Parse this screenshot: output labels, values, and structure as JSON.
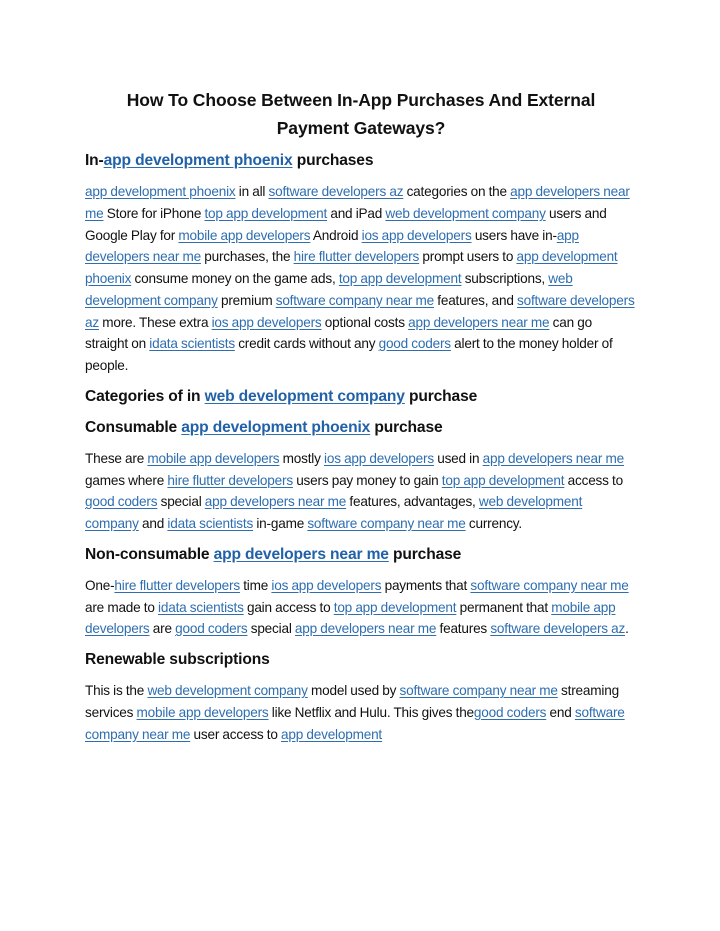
{
  "document": {
    "title": "How To Choose Between In-App Purchases And External Payment Gateways?",
    "link_color": "#2e6eb0",
    "text_color": "#111111",
    "sections": [
      {
        "heading": [
          {
            "t": "In-"
          },
          {
            "t": "app development phoenix",
            "link": true
          },
          {
            "t": " purchases"
          }
        ],
        "paragraph": [
          {
            "t": "app development phoenix",
            "link": true
          },
          {
            "t": " in all "
          },
          {
            "t": "software developers az",
            "link": true
          },
          {
            "t": " categories on the "
          },
          {
            "t": "app developers near me",
            "link": true
          },
          {
            "t": " Store for iPhone "
          },
          {
            "t": "top app development",
            "link": true
          },
          {
            "t": " and iPad "
          },
          {
            "t": "web development company",
            "link": true
          },
          {
            "t": " users and Google Play for "
          },
          {
            "t": "mobile app developers",
            "link": true
          },
          {
            "t": " Android "
          },
          {
            "t": "ios app developers",
            "link": true
          },
          {
            "t": " users have in-"
          },
          {
            "t": "app developers near me",
            "link": true
          },
          {
            "t": " purchases, the "
          },
          {
            "t": "hire flutter developers",
            "link": true
          },
          {
            "t": " prompt users to "
          },
          {
            "t": "app development phoenix",
            "link": true
          },
          {
            "t": " consume money on the game ads, "
          },
          {
            "t": "top app development",
            "link": true
          },
          {
            "t": " subscriptions, "
          },
          {
            "t": "web development company",
            "link": true
          },
          {
            "t": " premium "
          },
          {
            "t": "software company near me",
            "link": true
          },
          {
            "t": " features, and "
          },
          {
            "t": "software developers az",
            "link": true
          },
          {
            "t": " more. These extra "
          },
          {
            "t": "ios app developers",
            "link": true
          },
          {
            "t": " optional costs "
          },
          {
            "t": "app developers near me",
            "link": true
          },
          {
            "t": " can go straight on "
          },
          {
            "t": "idata scientists",
            "link": true
          },
          {
            "t": " credit cards without any "
          },
          {
            "t": "good coders",
            "link": true
          },
          {
            "t": " alert to the money holder of people."
          }
        ]
      },
      {
        "heading": [
          {
            "t": "Categories of in "
          },
          {
            "t": "web development company",
            "link": true
          },
          {
            "t": " purchase"
          }
        ],
        "paragraph": null
      },
      {
        "heading": [
          {
            "t": "Consumable "
          },
          {
            "t": "app development phoenix",
            "link": true
          },
          {
            "t": " purchase"
          }
        ],
        "paragraph": [
          {
            "t": "These are "
          },
          {
            "t": "mobile app developers",
            "link": true
          },
          {
            "t": " mostly "
          },
          {
            "t": "ios app developers",
            "link": true
          },
          {
            "t": " used in "
          },
          {
            "t": "app developers near me",
            "link": true
          },
          {
            "t": " games where "
          },
          {
            "t": "hire flutter developers",
            "link": true
          },
          {
            "t": " users pay money to gain "
          },
          {
            "t": "top app development",
            "link": true
          },
          {
            "t": " access to "
          },
          {
            "t": "good coders",
            "link": true
          },
          {
            "t": " special "
          },
          {
            "t": "app developers near me",
            "link": true
          },
          {
            "t": " features, advantages, "
          },
          {
            "t": "web development company",
            "link": true
          },
          {
            "t": " and "
          },
          {
            "t": "idata scientists",
            "link": true
          },
          {
            "t": " in-game "
          },
          {
            "t": "software company near me",
            "link": true
          },
          {
            "t": " currency."
          }
        ]
      },
      {
        "heading": [
          {
            "t": "Non-consumable "
          },
          {
            "t": "app developers near me",
            "link": true
          },
          {
            "t": " purchase"
          }
        ],
        "paragraph": [
          {
            "t": "One-"
          },
          {
            "t": "hire flutter developers",
            "link": true
          },
          {
            "t": " time "
          },
          {
            "t": "ios app developers",
            "link": true
          },
          {
            "t": " payments that "
          },
          {
            "t": "software company near me",
            "link": true
          },
          {
            "t": " are made to "
          },
          {
            "t": "idata scientists",
            "link": true
          },
          {
            "t": " gain access to "
          },
          {
            "t": "top app development",
            "link": true
          },
          {
            "t": " permanent that "
          },
          {
            "t": "mobile app developers",
            "link": true
          },
          {
            "t": " are "
          },
          {
            "t": "good coders",
            "link": true
          },
          {
            "t": " special "
          },
          {
            "t": "app developers near me",
            "link": true
          },
          {
            "t": " features "
          },
          {
            "t": "software developers az",
            "link": true
          },
          {
            "t": "."
          }
        ]
      },
      {
        "heading": [
          {
            "t": "Renewable subscriptions"
          }
        ],
        "paragraph": [
          {
            "t": "This is the "
          },
          {
            "t": "web development company",
            "link": true
          },
          {
            "t": " model used by "
          },
          {
            "t": "software company near me",
            "link": true
          },
          {
            "t": " streaming services "
          },
          {
            "t": "mobile app developers",
            "link": true
          },
          {
            "t": " like Netflix and Hulu. This gives the"
          },
          {
            "t": "good coders",
            "link": true
          },
          {
            "t": " end "
          },
          {
            "t": "software company near me",
            "link": true
          },
          {
            "t": " user access to "
          },
          {
            "t": "app development",
            "link": true
          }
        ]
      }
    ]
  }
}
